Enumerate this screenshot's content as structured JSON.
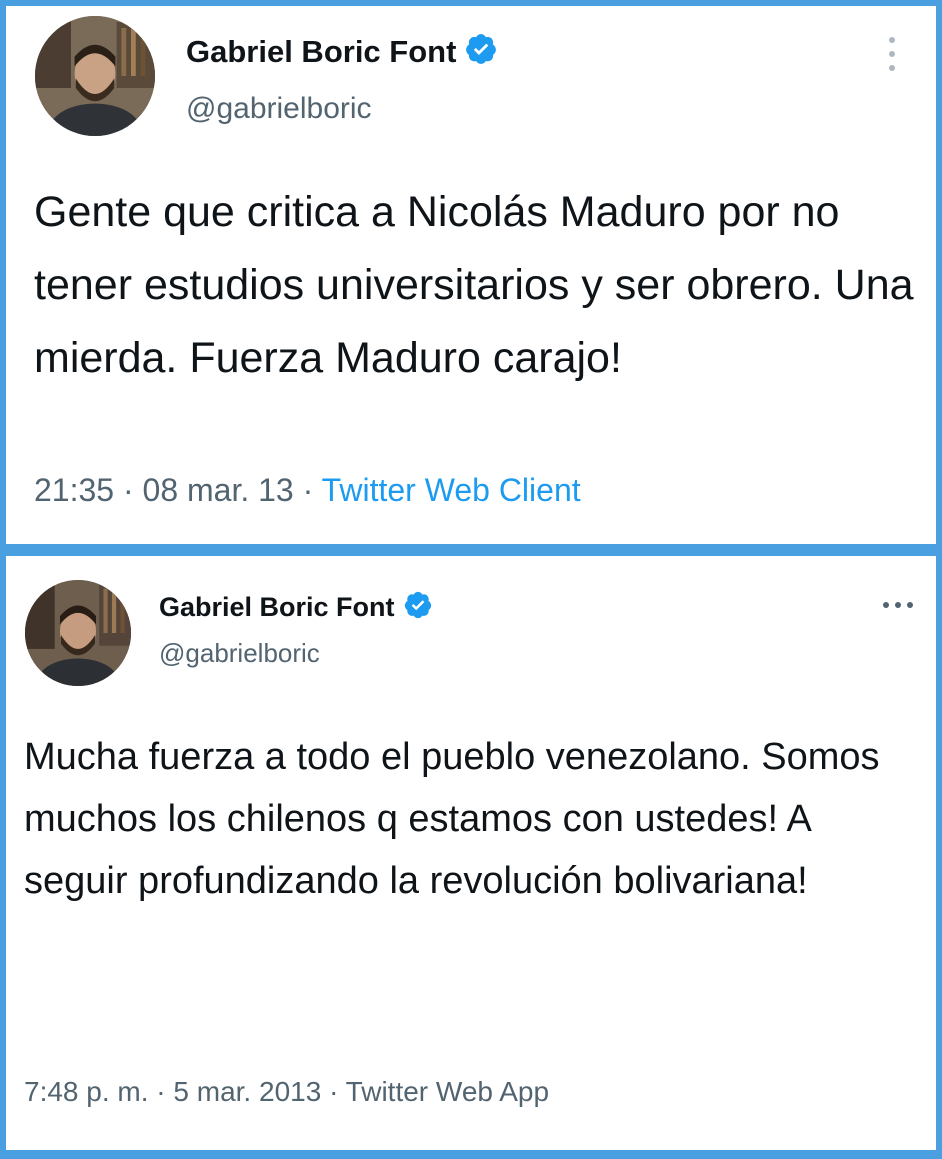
{
  "tweets": [
    {
      "author_name": "Gabriel Boric Font",
      "handle": "@gabrielboric",
      "text": "Gente que critica a Nicolás Maduro por no tener estudios universitarios y ser obrero. Una mierda. Fuerza Maduro carajo!",
      "time": "21:35",
      "date": "08 mar. 13",
      "source": "Twitter Web Client",
      "separator": "·",
      "more_icon": "vertical-ellipsis-icon"
    },
    {
      "author_name": "Gabriel Boric Font",
      "handle": "@gabrielboric",
      "text": "Mucha fuerza a todo el pueblo venezolano. Somos muchos los chilenos q estamos con ustedes! A seguir profundizando la revolución bolivariana!",
      "time": "7:48 p. m.",
      "date": "5 mar. 2013",
      "source": "Twitter Web App",
      "separator": "·",
      "more_icon": "horizontal-ellipsis-icon"
    }
  ],
  "colors": {
    "frame": "#4a9fe0",
    "verified": "#1d9bf0",
    "link": "#1d9bf0",
    "muted": "#536471",
    "text": "#0f1419"
  }
}
